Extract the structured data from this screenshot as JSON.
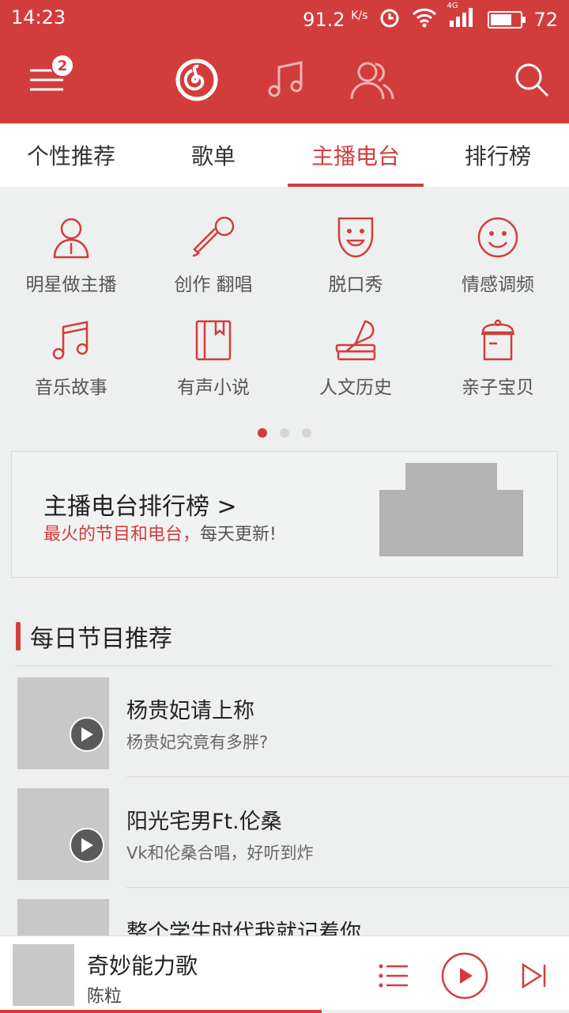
{
  "status": {
    "time": "14:23",
    "speed": "91.2",
    "speed_unit": "K/s",
    "network": "4G",
    "battery": "72",
    "battery_level": 0.72
  },
  "top_bar": {
    "menu_badge": "2",
    "accent": "#d23d3c"
  },
  "tabs": [
    {
      "label": "个性推荐"
    },
    {
      "label": "歌单"
    },
    {
      "label": "主播电台"
    },
    {
      "label": "排行榜"
    }
  ],
  "categories": [
    {
      "label": "明星做主播",
      "icon": "star-host-icon"
    },
    {
      "label": "创作 翻唱",
      "icon": "microphone-icon"
    },
    {
      "label": "脱口秀",
      "icon": "mask-icon"
    },
    {
      "label": "情感调频",
      "icon": "smiley-icon"
    },
    {
      "label": "音乐故事",
      "icon": "music-note-icon"
    },
    {
      "label": "有声小说",
      "icon": "book-icon"
    },
    {
      "label": "人文历史",
      "icon": "quill-books-icon"
    },
    {
      "label": "亲子宝贝",
      "icon": "pot-icon"
    }
  ],
  "pager": {
    "count": 3,
    "active": 0
  },
  "banner": {
    "title": "主播电台排行榜 >",
    "sub_red": "最火的节目和电台，",
    "sub_grey": "每天更新!"
  },
  "section": {
    "title": "每日节目推荐"
  },
  "list": [
    {
      "title": "杨贵妃请上称",
      "subtitle": "杨贵妃究竟有多胖?"
    },
    {
      "title": "阳光宅男Ft.伦桑",
      "subtitle": "Vk和伦桑合唱，好听到炸"
    },
    {
      "title": "整个学生时代我就记着你",
      "subtitle": ""
    }
  ],
  "player": {
    "song": "奇妙能力歌",
    "artist": "陈粒",
    "progress": 0.565
  }
}
